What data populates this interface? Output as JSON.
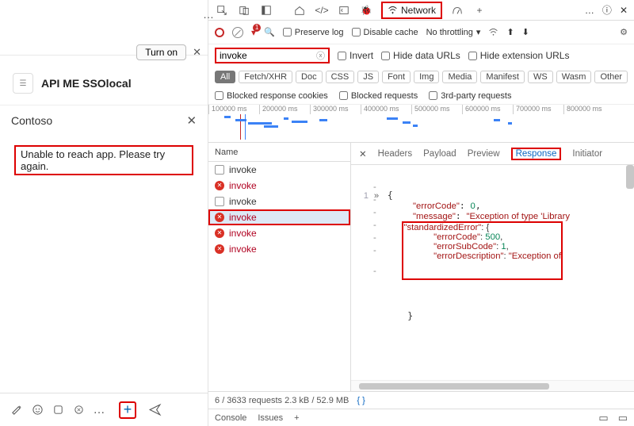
{
  "chat": {
    "turn_on_label": "Turn on",
    "subject": "API ME SSOlocal",
    "subject_icon_glyph": "☰",
    "contoso_title": "Contoso",
    "error_message": "Unable to reach app. Please try again.",
    "toolbar": {
      "plus_label": "+"
    }
  },
  "devtools": {
    "tabs": {
      "network": "Network"
    },
    "toolbar": {
      "preserve_log": "Preserve log",
      "disable_cache": "Disable cache",
      "throttling": "No throttling"
    },
    "filter": {
      "value": "invoke",
      "invert": "Invert",
      "hide_data": "Hide data URLs",
      "hide_ext": "Hide extension URLs"
    },
    "types": [
      "All",
      "Fetch/XHR",
      "Doc",
      "CSS",
      "JS",
      "Font",
      "Img",
      "Media",
      "Manifest",
      "WS",
      "Wasm",
      "Other"
    ],
    "blocked": {
      "cookies": "Blocked response cookies",
      "requests": "Blocked requests",
      "thirdparty": "3rd-party requests"
    },
    "waterfall_ticks": [
      "100000 ms",
      "200000 ms",
      "300000 ms",
      "400000 ms",
      "500000 ms",
      "600000 ms",
      "700000 ms",
      "800000 ms"
    ],
    "request_header": "Name",
    "requests": [
      {
        "name": "invoke",
        "status": "blocked"
      },
      {
        "name": "invoke",
        "status": "failed"
      },
      {
        "name": "invoke",
        "status": "blocked"
      },
      {
        "name": "invoke",
        "status": "failed",
        "selected": true
      },
      {
        "name": "invoke",
        "status": "failed"
      },
      {
        "name": "invoke",
        "status": "failed"
      }
    ],
    "response_tabs": [
      "Headers",
      "Payload",
      "Preview",
      "Response",
      "Initiator"
    ],
    "response_active": "Response",
    "response_json": {
      "line1_key": "\"errorCode\"",
      "line1_val": "0",
      "line2_key": "\"message\"",
      "line2_val": "\"Exception of type 'Library",
      "line3_key": "\"standardizedError\"",
      "line3_val": "{",
      "line4_key": "\"errorCode\"",
      "line4_val": "500",
      "line5_key": "\"errorSubCode\"",
      "line5_val": "1",
      "line6_key": "\"errorDescription\"",
      "line6_val": "\"Exception of"
    },
    "status_bar": "6 / 3633 requests   2.3 kB / 52.9 MB",
    "drawer": {
      "console": "Console",
      "issues": "Issues"
    }
  }
}
